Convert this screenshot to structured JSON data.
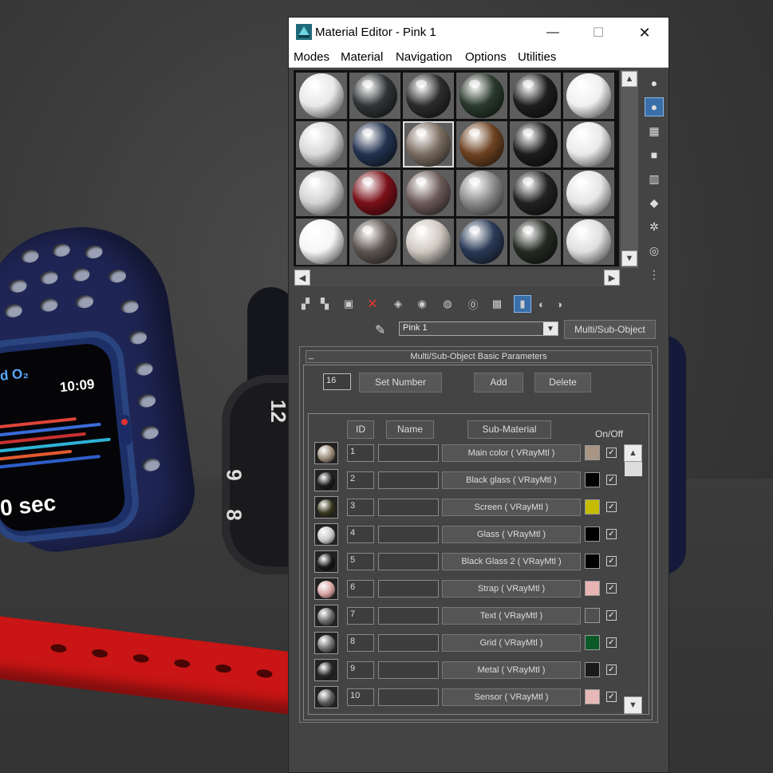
{
  "window": {
    "title": "Material Editor - Pink 1",
    "controls": {
      "minimize": "—",
      "maximize": "☐",
      "close": "✕"
    }
  },
  "menu": [
    "Modes",
    "Material",
    "Navigation",
    "Options",
    "Utilities"
  ],
  "viewport": {
    "watch_o2": "d O₂",
    "watch_time": "10:09",
    "watch_sec": "0 sec",
    "watch2_numbers": [
      "12",
      "9",
      "8"
    ]
  },
  "slots": [
    [
      "#e8e8e8",
      "#303436",
      "#2c2c2c",
      "#2a3a2c",
      "#1e1e1e",
      "#f0f0f0"
    ],
    [
      "#d8d8d8",
      "#23324f",
      "#7a6c60",
      "#6e4222",
      "#1c1c1c",
      "#eaeaea"
    ],
    [
      "#d2d2d2",
      "#7a1018",
      "#6b5a58",
      "#8a8a8a",
      "#222222",
      "#e6e6e6"
    ],
    [
      "#f6f6f6",
      "#5c5450",
      "#cfc8c0",
      "#2a3a56",
      "#252a22",
      "#e0e0e0"
    ]
  ],
  "material": {
    "name": "Pink 1",
    "type": "Multi/Sub-Object",
    "rollout_title": "Multi/Sub-Object Basic Parameters",
    "rollout_toggle": "_"
  },
  "controls": {
    "number": "16",
    "set_number": "Set Number",
    "add": "Add",
    "delete": "Delete"
  },
  "columns": {
    "id": "ID",
    "name": "Name",
    "sub_material": "Sub-Material",
    "on_off": "On/Off"
  },
  "rows": [
    {
      "id": "1",
      "label": "Main color  ( VRayMtl )",
      "swatch": "#a89584",
      "thumb": "#9a8a78",
      "checked": "✓"
    },
    {
      "id": "2",
      "label": "Black glass  ( VRayMtl )",
      "swatch": "#000000",
      "thumb": "#1c1c1c",
      "checked": "✓"
    },
    {
      "id": "3",
      "label": "Screen  ( VRayMtl )",
      "swatch": "#c4bc00",
      "thumb": "#3a3a20",
      "checked": "✓"
    },
    {
      "id": "4",
      "label": "Glass  ( VRayMtl )",
      "swatch": "#000000",
      "thumb": "#c8c8c8",
      "checked": "✓"
    },
    {
      "id": "5",
      "label": "Black Glass 2  ( VRayMtl )",
      "swatch": "#000000",
      "thumb": "#181818",
      "checked": "✓"
    },
    {
      "id": "6",
      "label": "Strap  ( VRayMtl )",
      "swatch": "#e8b4b4",
      "thumb": "#d8a2a2",
      "checked": "✓"
    },
    {
      "id": "7",
      "label": "Text  ( VRayMtl )",
      "swatch": "#505050",
      "thumb": "#6a6a6a",
      "checked": "✓"
    },
    {
      "id": "8",
      "label": "Grid  ( VRayMtl )",
      "swatch": "#0b5a28",
      "thumb": "#707070",
      "checked": "✓"
    },
    {
      "id": "9",
      "label": "Metal  ( VRayMtl )",
      "swatch": "#1a1a1a",
      "thumb": "#2a2a2a",
      "checked": "✓"
    },
    {
      "id": "10",
      "label": "Sensor  ( VRayMtl )",
      "swatch": "#e6b8b8",
      "thumb": "#5c5c5c",
      "checked": "✓"
    }
  ]
}
